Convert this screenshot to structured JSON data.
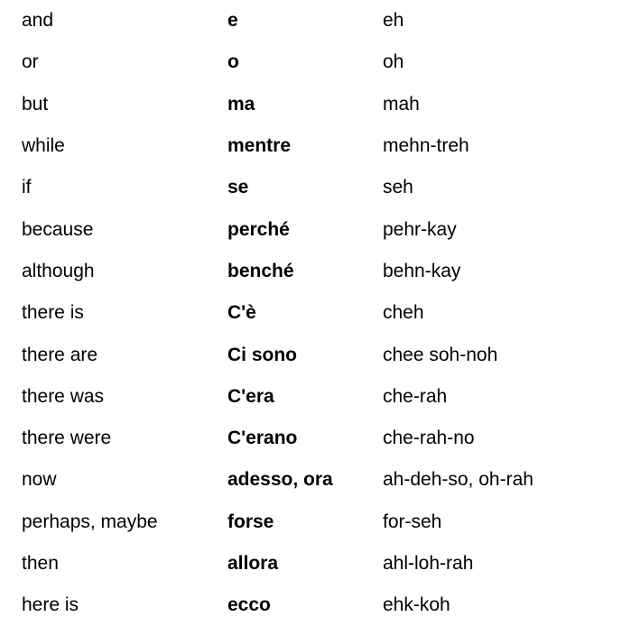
{
  "rows": [
    {
      "english": "and",
      "italian": "e",
      "pronunciation": "eh"
    },
    {
      "english": "or",
      "italian": "o",
      "pronunciation": "oh"
    },
    {
      "english": "but",
      "italian": "ma",
      "pronunciation": "mah"
    },
    {
      "english": "while",
      "italian": "mentre",
      "pronunciation": "mehn-treh"
    },
    {
      "english": "if",
      "italian": "se",
      "pronunciation": "seh"
    },
    {
      "english": "because",
      "italian": "perché",
      "pronunciation": "pehr-kay"
    },
    {
      "english": "although",
      "italian": "benché",
      "pronunciation": "behn-kay"
    },
    {
      "english": "there is",
      "italian": "C'è",
      "pronunciation": "cheh"
    },
    {
      "english": "there are",
      "italian": "Ci sono",
      "pronunciation": "chee soh-noh"
    },
    {
      "english": "there was",
      "italian": "C'era",
      "pronunciation": "che-rah"
    },
    {
      "english": "there were",
      "italian": "C'erano",
      "pronunciation": "che-rah-no"
    },
    {
      "english": "now",
      "italian": "adesso, ora",
      "pronunciation": "ah-deh-so, oh-rah"
    },
    {
      "english": "perhaps, maybe",
      "italian": "forse",
      "pronunciation": "for-seh"
    },
    {
      "english": "then",
      "italian": "allora",
      "pronunciation": "ahl-loh-rah"
    },
    {
      "english": "here is",
      "italian": "ecco",
      "pronunciation": "ehk-koh"
    }
  ]
}
